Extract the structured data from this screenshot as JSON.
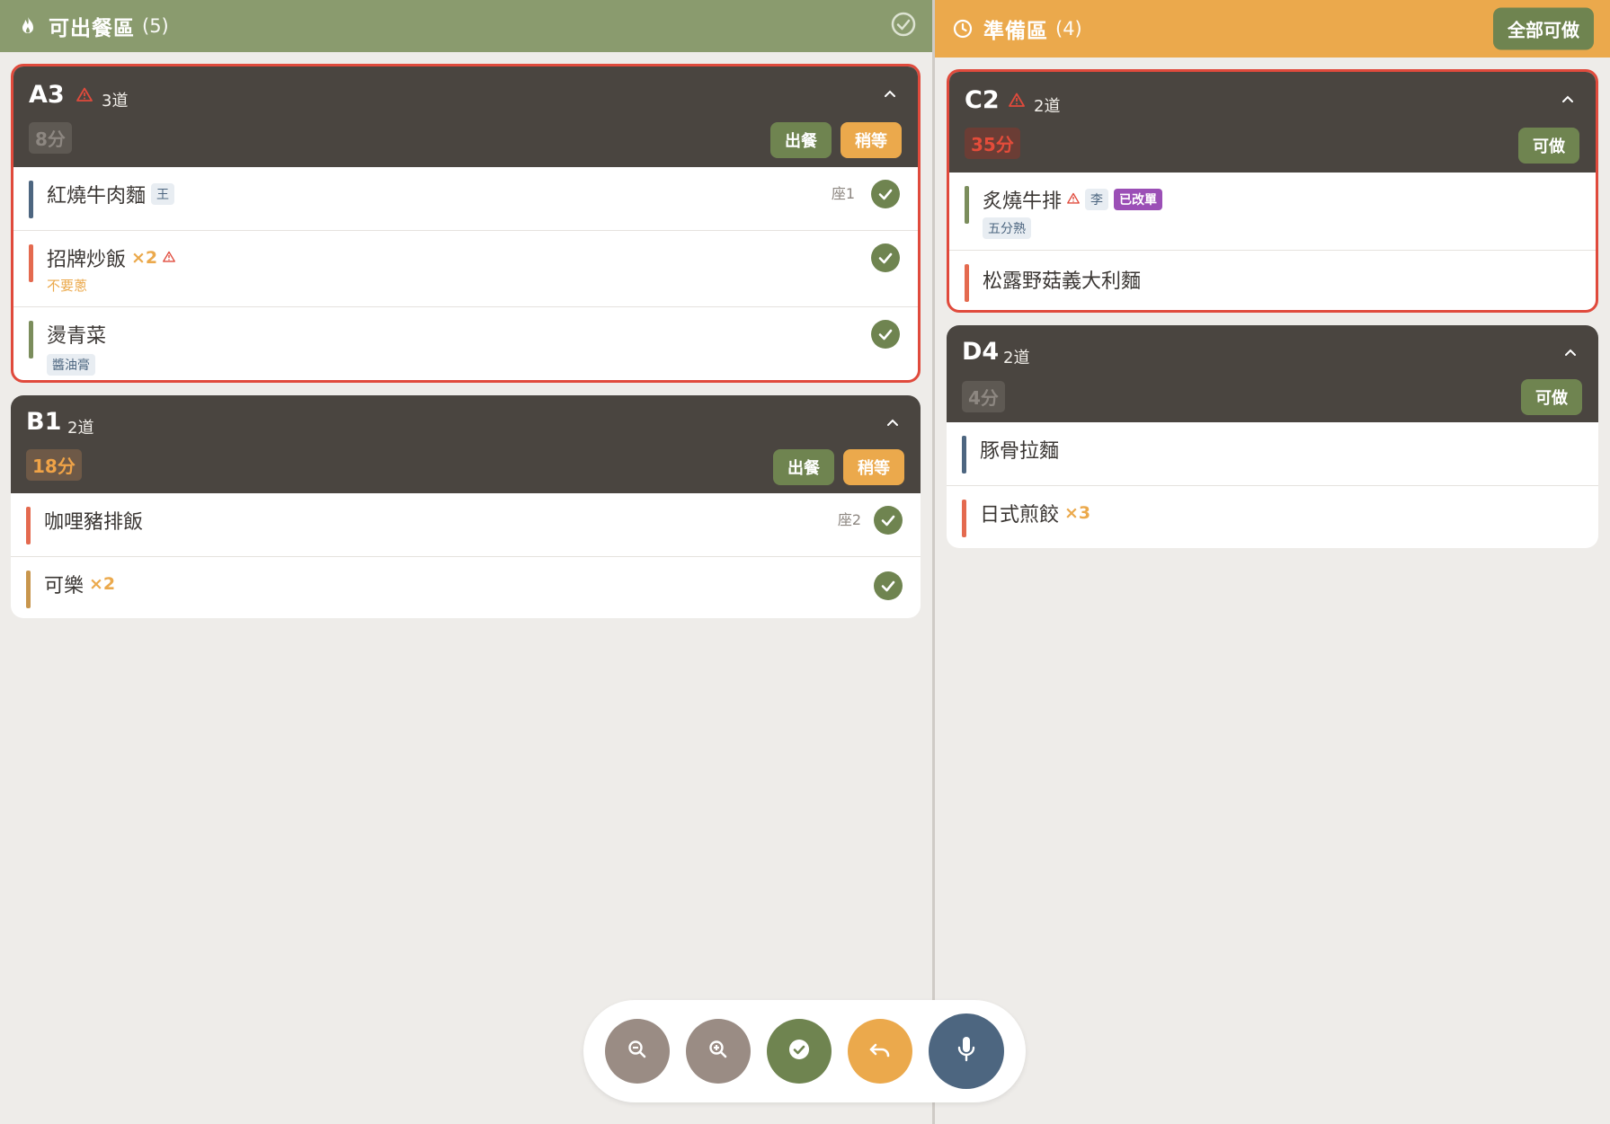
{
  "colors": {
    "ready_header": "#8a9b6e",
    "prep_header": "#eba94c",
    "card_head": "#4a4540",
    "urgent_border": "#e04a3c",
    "green": "#6f8450",
    "orange": "#eba94c",
    "modified": "#9b4fb6",
    "mic": "#4d6680"
  },
  "ready": {
    "icon": "flame-icon",
    "title": "可出餐區",
    "count": "(5)",
    "right_icon": "check-circle-icon",
    "orders": [
      {
        "table": "A3",
        "urgent": true,
        "dishes": "3道",
        "time": "8分",
        "serve_label": "出餐",
        "wait_label": "稍等",
        "items": [
          {
            "name": "紅燒牛肉麵",
            "tag": "王",
            "seat": "座1",
            "color": "blue"
          },
          {
            "name": "招牌炒飯",
            "qty": "×2",
            "warn": true,
            "note": "不要蔥",
            "color": "red"
          },
          {
            "name": "燙青菜",
            "tag": "醬油膏",
            "color": "green"
          }
        ]
      },
      {
        "table": "B1",
        "urgent": false,
        "dishes": "2道",
        "time": "18分",
        "serve_label": "出餐",
        "wait_label": "稍等",
        "items": [
          {
            "name": "咖哩豬排飯",
            "seat": "座2",
            "color": "red"
          },
          {
            "name": "可樂",
            "qty": "×2",
            "color": "tan"
          }
        ]
      }
    ]
  },
  "prep": {
    "icon": "clock-icon",
    "title": "準備區",
    "count": "(4)",
    "all_ready_label": "全部可做",
    "orders": [
      {
        "table": "C2",
        "urgent": true,
        "dishes": "2道",
        "time": "35分",
        "ready_label": "可做",
        "items": [
          {
            "name": "炙燒牛排",
            "warn": true,
            "tag": "李",
            "modified": "已改單",
            "sub_tag": "五分熟",
            "color": "green"
          },
          {
            "name": "松露野菇義大利麵",
            "color": "red"
          }
        ]
      },
      {
        "table": "D4",
        "urgent": false,
        "dishes": "2道",
        "time": "4分",
        "ready_label": "可做",
        "items": [
          {
            "name": "豚骨拉麵",
            "color": "blue"
          },
          {
            "name": "日式煎餃",
            "qty": "×3",
            "color": "red"
          }
        ]
      }
    ]
  },
  "toolbar": {
    "zoom_out": {
      "icon": "zoom-out-icon",
      "color": "#9a8c84"
    },
    "zoom_in": {
      "icon": "zoom-in-icon",
      "color": "#9a8c84"
    },
    "complete": {
      "icon": "check-icon",
      "color": "#6f8450"
    },
    "undo": {
      "icon": "undo-icon",
      "color": "#eba94c"
    },
    "mic": {
      "icon": "microphone-icon",
      "color": "#4d6680"
    }
  }
}
